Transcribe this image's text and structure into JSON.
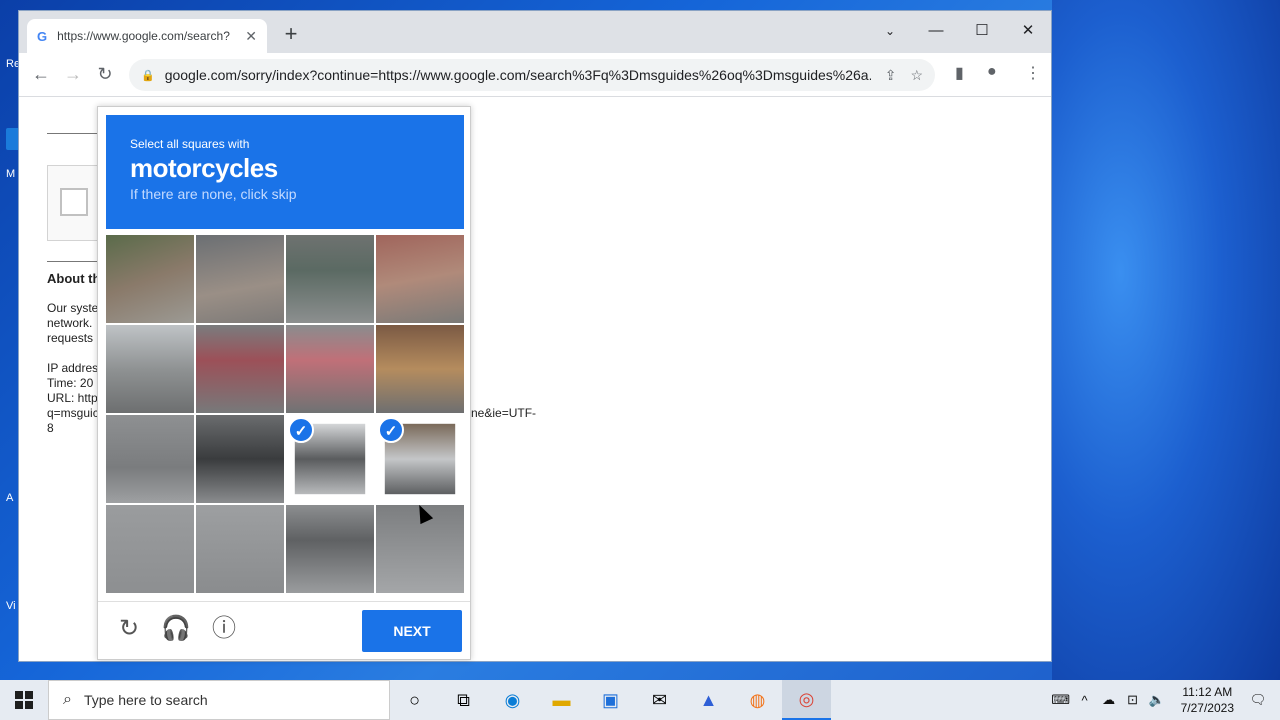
{
  "browser": {
    "tab_title": "https://www.google.com/search?",
    "url": "google.com/sorry/index?continue=https://www.google.com/search%3Fq%3Dmsguides%26oq%3Dmsguides%26a..."
  },
  "background_page": {
    "about_heading": "About th",
    "para": [
      "Our syste",
      "network.",
      "requests"
    ],
    "ip_lines": [
      "IP addres",
      "Time: 20",
      "URL: http",
      "q=msguic",
      "8"
    ],
    "url_tail": "ne&ie=UTF-"
  },
  "captcha": {
    "instruction": "Select all squares with",
    "target": "motorcycles",
    "hint": "If there are none, click skip",
    "selected_cells": [
      10,
      11
    ],
    "next_label": "NEXT"
  },
  "taskbar": {
    "search_placeholder": "Type here to search",
    "time": "11:12 AM",
    "date": "7/27/2023"
  },
  "desktop": {
    "labels": [
      "Re",
      "M",
      "A",
      "Vi"
    ]
  },
  "colors": {
    "captcha_blue": "#1a73e8"
  }
}
